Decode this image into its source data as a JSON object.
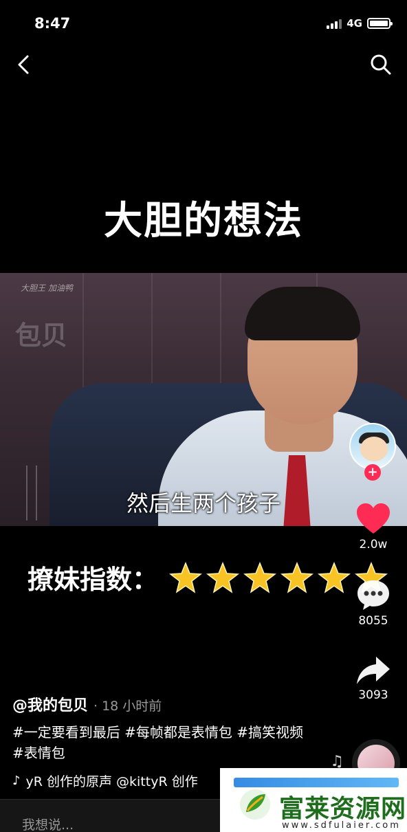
{
  "status_bar": {
    "time": "8:47",
    "network": "4G"
  },
  "video": {
    "headline": "大胆的想法",
    "subtitle": "然后生两个孩子",
    "watermark": "包贝",
    "corner_text": "大胆王 加油鸭",
    "rating_label": "撩妹指数：",
    "rating_stars": 6
  },
  "rail": {
    "likes": "2.0w",
    "comments": "8055",
    "shares": "3093",
    "follow_symbol": "+"
  },
  "caption": {
    "author": "@我的包贝",
    "time_ago": "· 18 小时前",
    "hashtags_line1": "#一定要看到最后 #每帧都是表情包 #搞笑视频",
    "hashtags_line2": "#表情包",
    "sound": "yR 创作的原声    @kittyR 创作"
  },
  "comment_bar": {
    "placeholder": "我想说..."
  },
  "ad": {
    "title": "富莱资源网",
    "url": "www.sdfulaier.com"
  },
  "colors": {
    "like": "#fe2c55",
    "ad_green": "#1d6d1c"
  }
}
